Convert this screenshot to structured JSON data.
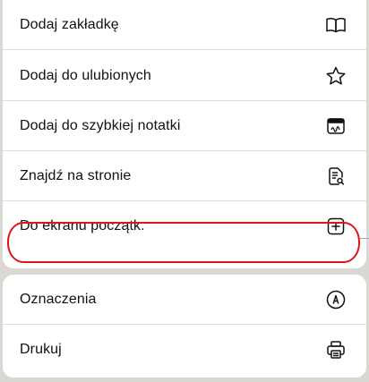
{
  "menu": {
    "items": [
      {
        "label": "Dodaj zakładkę",
        "icon": "book-icon"
      },
      {
        "label": "Dodaj do ulubionych",
        "icon": "star-icon"
      },
      {
        "label": "Dodaj do szybkiej notatki",
        "icon": "quick-note-icon"
      },
      {
        "label": "Znajdź na stronie",
        "icon": "find-on-page-icon"
      },
      {
        "label": "Do ekranu początk.",
        "icon": "add-square-icon"
      }
    ],
    "items2": [
      {
        "label": "Oznaczenia",
        "icon": "markup-pen-icon"
      },
      {
        "label": "Drukuj",
        "icon": "printer-icon"
      }
    ]
  },
  "annotation": {
    "color": "#e0141e"
  }
}
